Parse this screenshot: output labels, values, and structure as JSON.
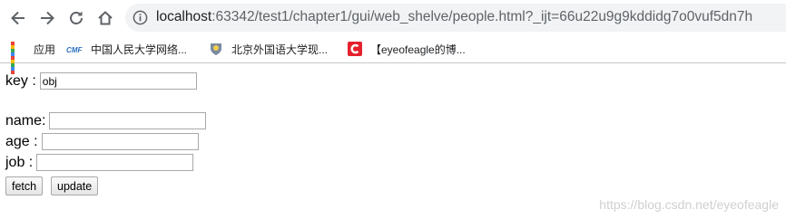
{
  "browser": {
    "url_host": "localhost",
    "url_rest": ":63342/test1/chapter1/gui/web_shelve/people.html?_ijt=66u22u9g9kddidg7o0vuf5dn7h"
  },
  "bookmarks": [
    {
      "label": "应用"
    },
    {
      "label": "中国人民大学网络..."
    },
    {
      "label": "北京外国语大学现..."
    },
    {
      "label": "【eyeofeagle的博..."
    }
  ],
  "form": {
    "key_label": "key :",
    "key_value": "obj",
    "name_label": "name:",
    "age_label": "age :",
    "job_label": "job :"
  },
  "buttons": {
    "fetch": "fetch",
    "update": "update"
  },
  "watermark": "https://blog.csdn.net/eyeofeagle",
  "colors": {
    "toolbar_bg": "#ffffff",
    "omnibox_bg": "#f1f3f4",
    "bookmark_red": "#e5212e"
  }
}
